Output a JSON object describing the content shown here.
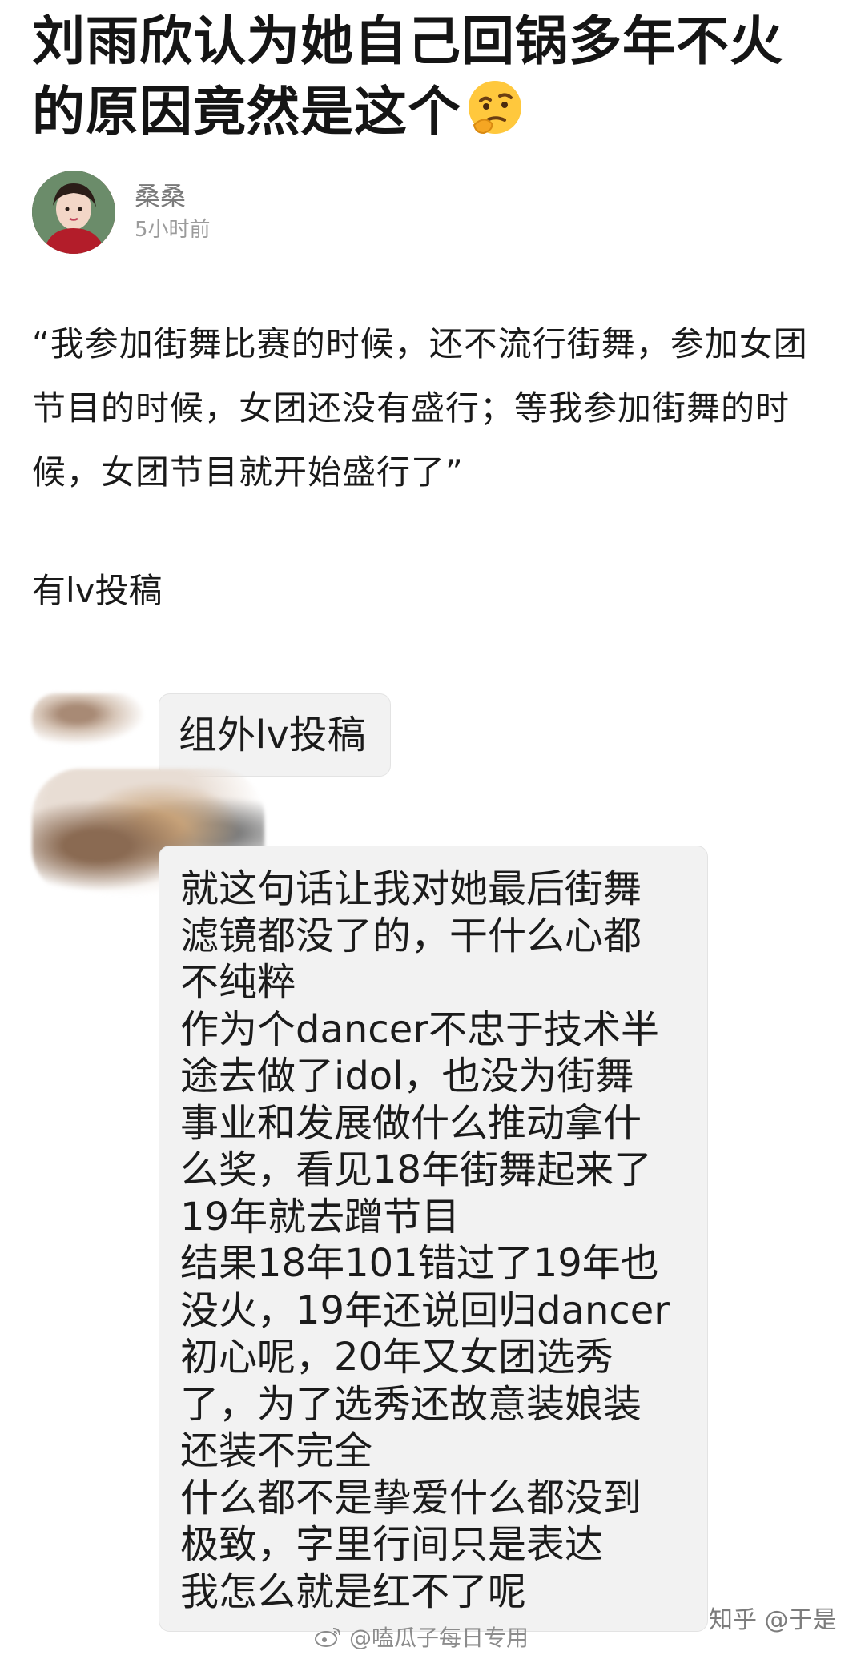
{
  "article": {
    "title": "刘雨欣认为她自己回锅多年不火的原因竟然是这个",
    "title_emoji": "thinking-face-emoji"
  },
  "author": {
    "name": "桑桑",
    "time": "5小时前"
  },
  "content": {
    "quote": "“我参加街舞比赛的时候，还不流行街舞，参加女团节目的时候，女团还没有盛行；等我参加街舞的时候，女团节目就开始盛行了”",
    "submission_note": "有lv投稿"
  },
  "chat": {
    "bubble1": "组外lv投稿",
    "bubble2_lines": [
      "就这句话让我对她最后街舞",
      "滤镜都没了的，干什么心都",
      "不纯粹",
      "作为个dancer不忠于技术半",
      "途去做了idol，也没为街舞",
      "事业和发展做什么推动拿什",
      "么奖，看见18年街舞起来了",
      "19年就去蹭节目",
      "结果18年101错过了19年也",
      "没火，19年还说回归dancer",
      "初心呢，20年又女团选秀",
      "了，为了选秀还故意装娘装",
      "还装不完全",
      "什么都不是挚爱什么都没到",
      "极致，字里行间只是表达",
      "我怎么就是红不了呢"
    ]
  },
  "watermarks": {
    "zhihu": "知乎 @于是",
    "weibo": "@嗑瓜子每日专用"
  },
  "icons": {
    "weibo": "weibo-icon",
    "avatar": "avatar"
  }
}
